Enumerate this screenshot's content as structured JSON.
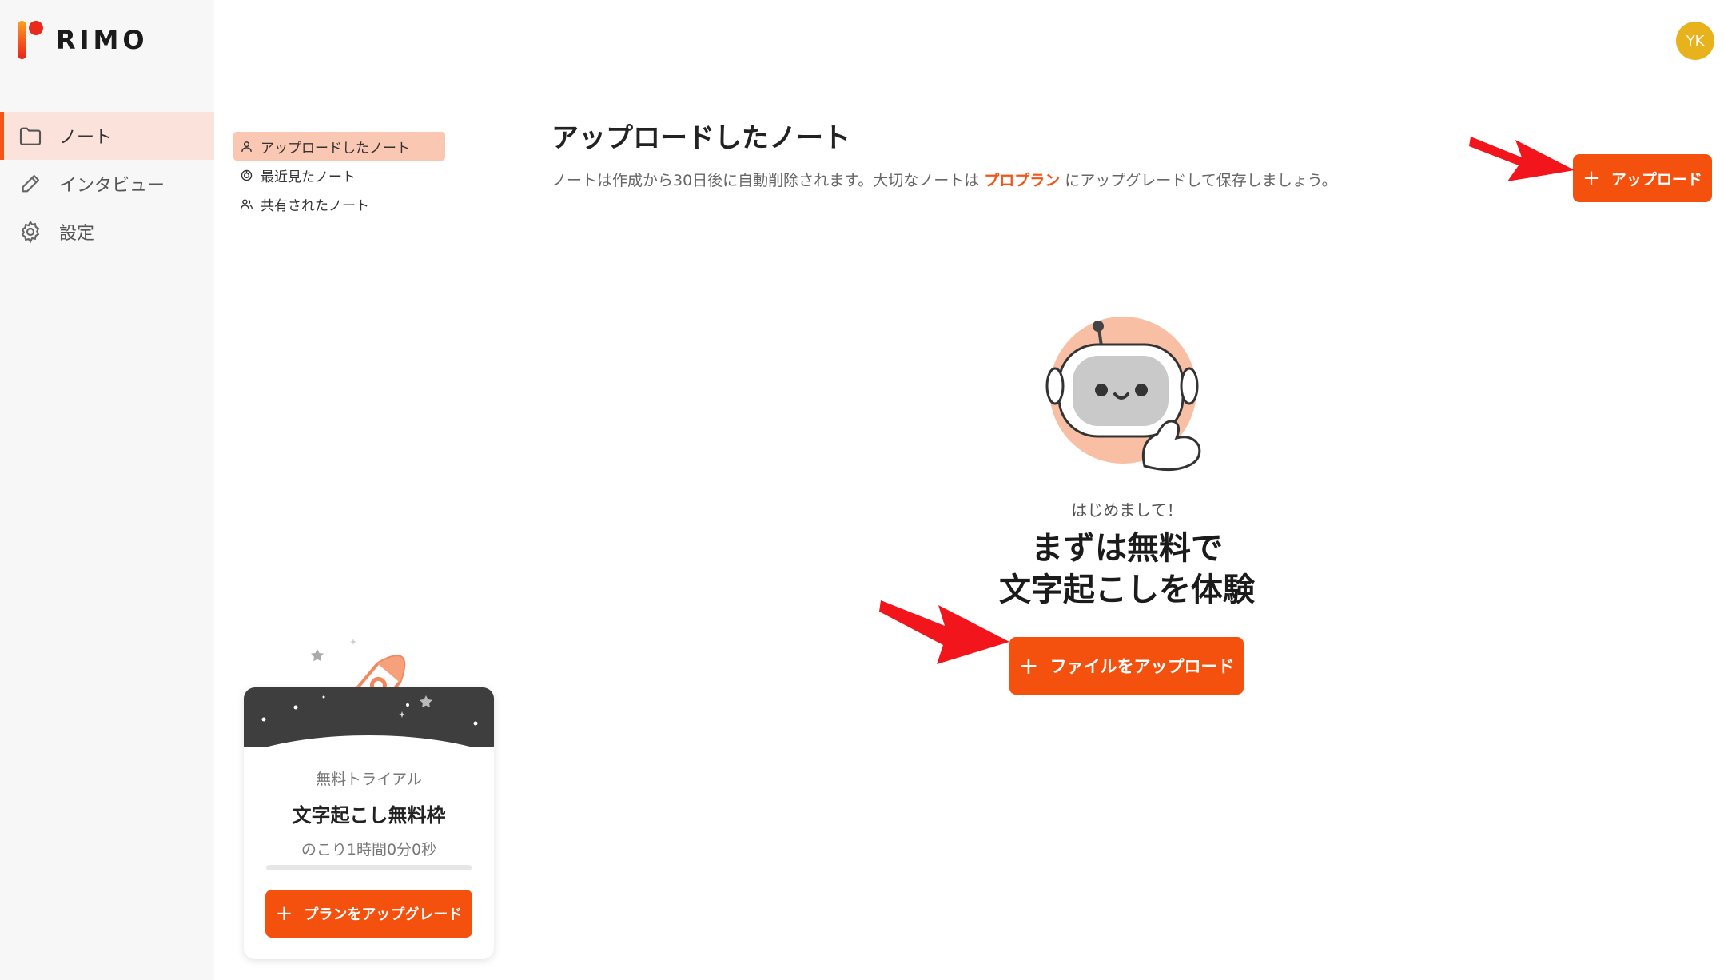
{
  "brand": {
    "name": "RIMO"
  },
  "nav": {
    "items": [
      {
        "label": "ノート",
        "icon": "folder-icon",
        "active": true
      },
      {
        "label": "インタビュー",
        "icon": "pen-icon",
        "active": false
      },
      {
        "label": "設定",
        "icon": "gear-icon",
        "active": false
      }
    ]
  },
  "subnav": {
    "items": [
      {
        "label": "アップロードしたノート",
        "icon": "person-icon",
        "active": true
      },
      {
        "label": "最近見たノート",
        "icon": "recent-icon",
        "active": false
      },
      {
        "label": "共有されたノート",
        "icon": "people-icon",
        "active": false
      }
    ]
  },
  "header": {
    "avatar_initials": "YK",
    "title": "アップロードしたノート",
    "description_before": "ノートは作成から30日後に自動削除されます。大切なノートは",
    "description_link": "プロプラン",
    "description_after": "にアップグレードして保存しましょう。",
    "upload_plus": "+",
    "upload_label": "アップロード"
  },
  "empty_state": {
    "greeting": "はじめまして！",
    "headline_line1": "まずは無料で",
    "headline_line2": "文字起こしを体験",
    "button_plus": "+",
    "button_label": "ファイルをアップロード"
  },
  "trial": {
    "label": "無料トライアル",
    "title": "文字起こし無料枠",
    "remaining": "のこり1時間0分0秒",
    "progress": 0,
    "button_plus": "+",
    "button_label": "プランをアップグレード"
  },
  "colors": {
    "accent": "#f4510f",
    "active_bg": "#fbe3db",
    "subnav_active_bg": "#fac7b2",
    "avatar": "#e8b21c",
    "annotation_arrow": "#f2151b"
  }
}
